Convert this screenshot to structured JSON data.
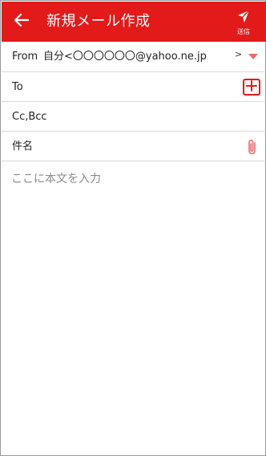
{
  "appbar": {
    "title": "新規メール作成",
    "send_label": "送信",
    "back_icon": "back-arrow-icon",
    "send_icon": "send-icon",
    "color": "#e21a1a"
  },
  "compose": {
    "from_label": "From",
    "from_value": "自分<〇〇〇〇〇〇@yahoo.ne.jp",
    "from_chevron": ">",
    "to_label": "To",
    "cc_label": "Cc,Bcc",
    "subject_label": "件名",
    "body_placeholder": "ここに本文を入力"
  }
}
